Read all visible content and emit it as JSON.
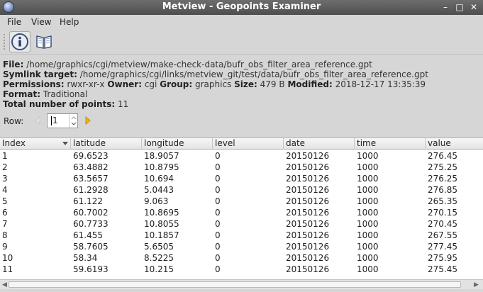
{
  "window": {
    "title": "Metview - Geopoints Examiner",
    "controls": [
      "–",
      "□",
      "✕"
    ]
  },
  "menubar": {
    "items": [
      "File",
      "View",
      "Help"
    ]
  },
  "toolbar": {
    "buttons": [
      {
        "icon": "info-icon",
        "active": true
      },
      {
        "icon": "book-icon",
        "active": false
      }
    ]
  },
  "info": {
    "file_label": "File:",
    "file_value": "/home/graphics/cgi/metview/make-check-data/bufr_obs_filter_area_reference.gpt",
    "symlink_label": "Symlink target:",
    "symlink_value": "/home/graphics/cgi/links/metview_git/test/data/bufr_obs_filter_area_reference.gpt",
    "permissions_label": "Permissions:",
    "permissions_value": "rwxr-xr-x",
    "owner_label": "Owner:",
    "owner_value": "cgi",
    "group_label": "Group:",
    "group_value": "graphics",
    "size_label": "Size:",
    "size_value": "479 B",
    "modified_label": "Modified:",
    "modified_value": "2018-12-17 13:35:39",
    "format_label": "Format:",
    "format_value": "Traditional",
    "total_label": "Total number of points:",
    "total_value": "11"
  },
  "row_control": {
    "label": "Row:",
    "value": "1"
  },
  "table": {
    "columns": [
      "Index",
      "latitude",
      "longitude",
      "level",
      "date",
      "time",
      "value"
    ],
    "rows": [
      [
        "1",
        "69.6523",
        "18.9057",
        "0",
        "20150126",
        "1000",
        "276.45"
      ],
      [
        "2",
        "63.4882",
        "10.8795",
        "0",
        "20150126",
        "1000",
        "275.25"
      ],
      [
        "3",
        "63.5657",
        "10.694",
        "0",
        "20150126",
        "1000",
        "276.25"
      ],
      [
        "4",
        "61.2928",
        "5.0443",
        "0",
        "20150126",
        "1000",
        "276.85"
      ],
      [
        "5",
        "61.122",
        "9.063",
        "0",
        "20150126",
        "1000",
        "265.35"
      ],
      [
        "6",
        "60.7002",
        "10.8695",
        "0",
        "20150126",
        "1000",
        "270.15"
      ],
      [
        "7",
        "60.7733",
        "10.8055",
        "0",
        "20150126",
        "1000",
        "270.45"
      ],
      [
        "8",
        "61.455",
        "10.1857",
        "0",
        "20150126",
        "1000",
        "267.55"
      ],
      [
        "9",
        "58.7605",
        "5.6505",
        "0",
        "20150126",
        "1000",
        "277.45"
      ],
      [
        "10",
        "58.34",
        "8.5225",
        "0",
        "20150126",
        "1000",
        "275.95"
      ],
      [
        "11",
        "59.6193",
        "10.215",
        "0",
        "20150126",
        "1000",
        "275.45"
      ]
    ]
  },
  "colors": {
    "titlebar": "#5a5a5a",
    "accent_arrow": "#f0b400"
  }
}
